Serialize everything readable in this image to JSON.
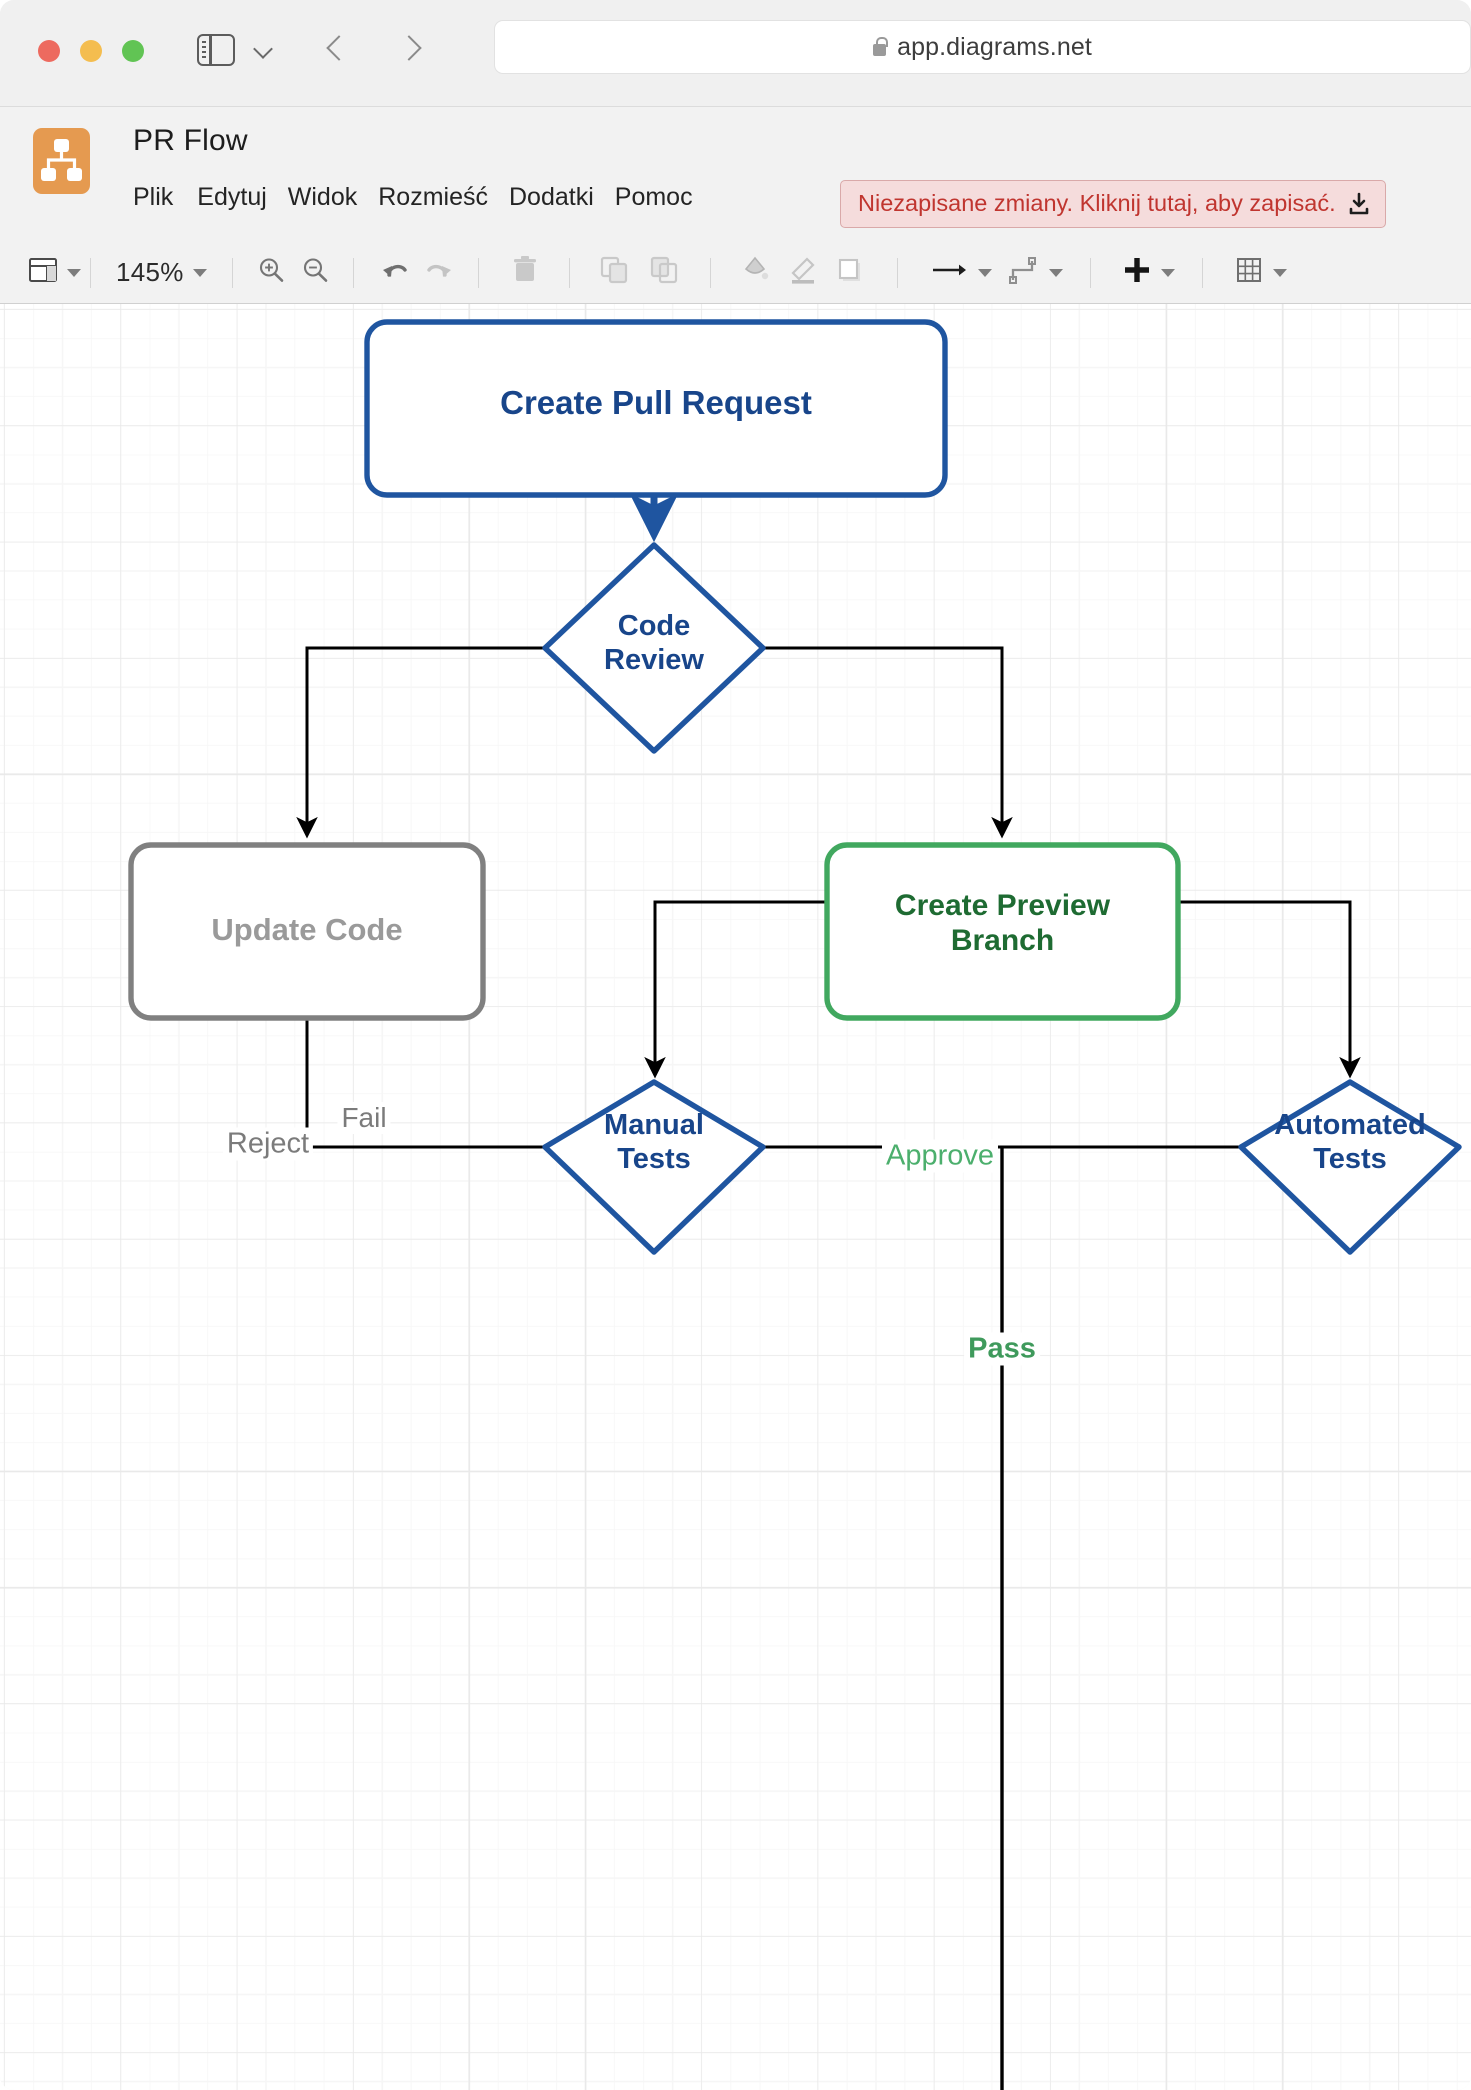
{
  "browser": {
    "url": "app.diagrams.net",
    "lock_icon": "lock-icon",
    "sidebar_icon": "sidebar-toggle-icon",
    "back_icon": "chevron-left-icon",
    "forward_icon": "chevron-right-icon",
    "tab_overview_icon": "chevron-down-icon"
  },
  "app": {
    "title": "PR Flow",
    "logo_icon": "diagrams-logo-icon",
    "menu": [
      {
        "label": "Plik"
      },
      {
        "label": "Edytuj"
      },
      {
        "label": "Widok"
      },
      {
        "label": "Rozmieść"
      },
      {
        "label": "Dodatki"
      },
      {
        "label": "Pomoc"
      }
    ],
    "save_badge": {
      "text": "Niezapisane zmiany. Kliknij tutaj, aby zapisać.",
      "icon": "download-icon",
      "text_color": "#c0352f",
      "bg_color": "#f5dcdc"
    }
  },
  "toolbar": {
    "view_label": "view-layout",
    "zoom_level": "145%",
    "items": [
      {
        "name": "view-layout-button",
        "icon": "layout-panel-icon"
      },
      {
        "name": "zoom-level-button",
        "icon": "zoom-dropdown"
      },
      {
        "name": "zoom-in-button",
        "icon": "zoom-in-icon"
      },
      {
        "name": "zoom-out-button",
        "icon": "zoom-out-icon"
      },
      {
        "name": "undo-button",
        "icon": "undo-icon"
      },
      {
        "name": "redo-button",
        "icon": "redo-icon"
      },
      {
        "name": "delete-button",
        "icon": "trash-icon"
      },
      {
        "name": "to-front-button",
        "icon": "bring-to-front-icon"
      },
      {
        "name": "to-back-button",
        "icon": "send-to-back-icon"
      },
      {
        "name": "fill-color-button",
        "icon": "paint-bucket-icon"
      },
      {
        "name": "line-color-button",
        "icon": "pencil-icon"
      },
      {
        "name": "shadow-button",
        "icon": "shadow-icon"
      },
      {
        "name": "connection-arrow-button",
        "icon": "arrow-icon"
      },
      {
        "name": "waypoints-button",
        "icon": "waypoint-icon"
      },
      {
        "name": "insert-button",
        "icon": "plus-icon"
      },
      {
        "name": "table-button",
        "icon": "table-icon"
      }
    ]
  },
  "diagram": {
    "colors": {
      "blue": "#1f55a0",
      "blue_text": "#18458a",
      "green": "#41a85f",
      "green_text": "#1e6b32",
      "gray": "#808080",
      "gray_text": "#9a9a9a",
      "edge": "#000000",
      "label_green": "#4caf6d",
      "label_gray": "#7b7b7b"
    },
    "nodes": [
      {
        "id": "create-pr",
        "label": "Create Pull Request",
        "shape": "rounded-rect",
        "style": "blue"
      },
      {
        "id": "code-review",
        "label": "Code\nReview",
        "shape": "diamond",
        "style": "blue"
      },
      {
        "id": "update-code",
        "label": "Update Code",
        "shape": "rounded-rect",
        "style": "gray"
      },
      {
        "id": "preview",
        "label": "Create Preview\nBranch",
        "shape": "rounded-rect",
        "style": "green"
      },
      {
        "id": "manual",
        "label": "Manual\nTests",
        "shape": "diamond",
        "style": "blue"
      },
      {
        "id": "automated",
        "label": "Automated\nTests",
        "shape": "diamond",
        "style": "blue"
      }
    ],
    "edge_labels": [
      {
        "id": "reject",
        "text": "Reject",
        "style": "gray"
      },
      {
        "id": "approve",
        "text": "Approve",
        "style": "green"
      },
      {
        "id": "fail",
        "text": "Fail",
        "style": "gray"
      },
      {
        "id": "pass",
        "text": "Pass",
        "style": "green"
      }
    ]
  }
}
